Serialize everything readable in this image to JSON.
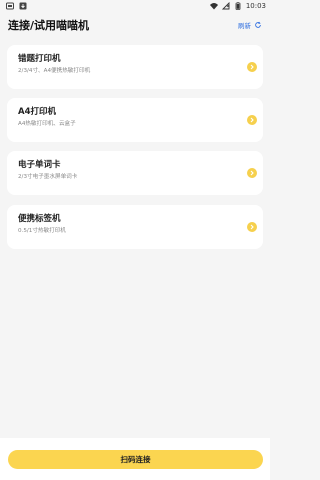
{
  "status_bar": {
    "time": "10:03"
  },
  "header": {
    "title": "连接/试用喵喵机",
    "refresh_label": "刷新"
  },
  "devices": [
    {
      "name": "错题打印机",
      "desc": "2/3/4寸、A4便携热敏打印机"
    },
    {
      "name": "A4打印机",
      "desc": "A4热敏打印机、云盒子"
    },
    {
      "name": "电子单词卡",
      "desc": "2/3寸电子墨水屏单词卡"
    },
    {
      "name": "便携标签机",
      "desc": "0.5/1寸热敏打印机"
    }
  ],
  "footer": {
    "scan_button_label": "扫码连接"
  },
  "colors": {
    "accent": "#fbd550",
    "link": "#2f6fe0",
    "background": "#f5f5f5"
  }
}
